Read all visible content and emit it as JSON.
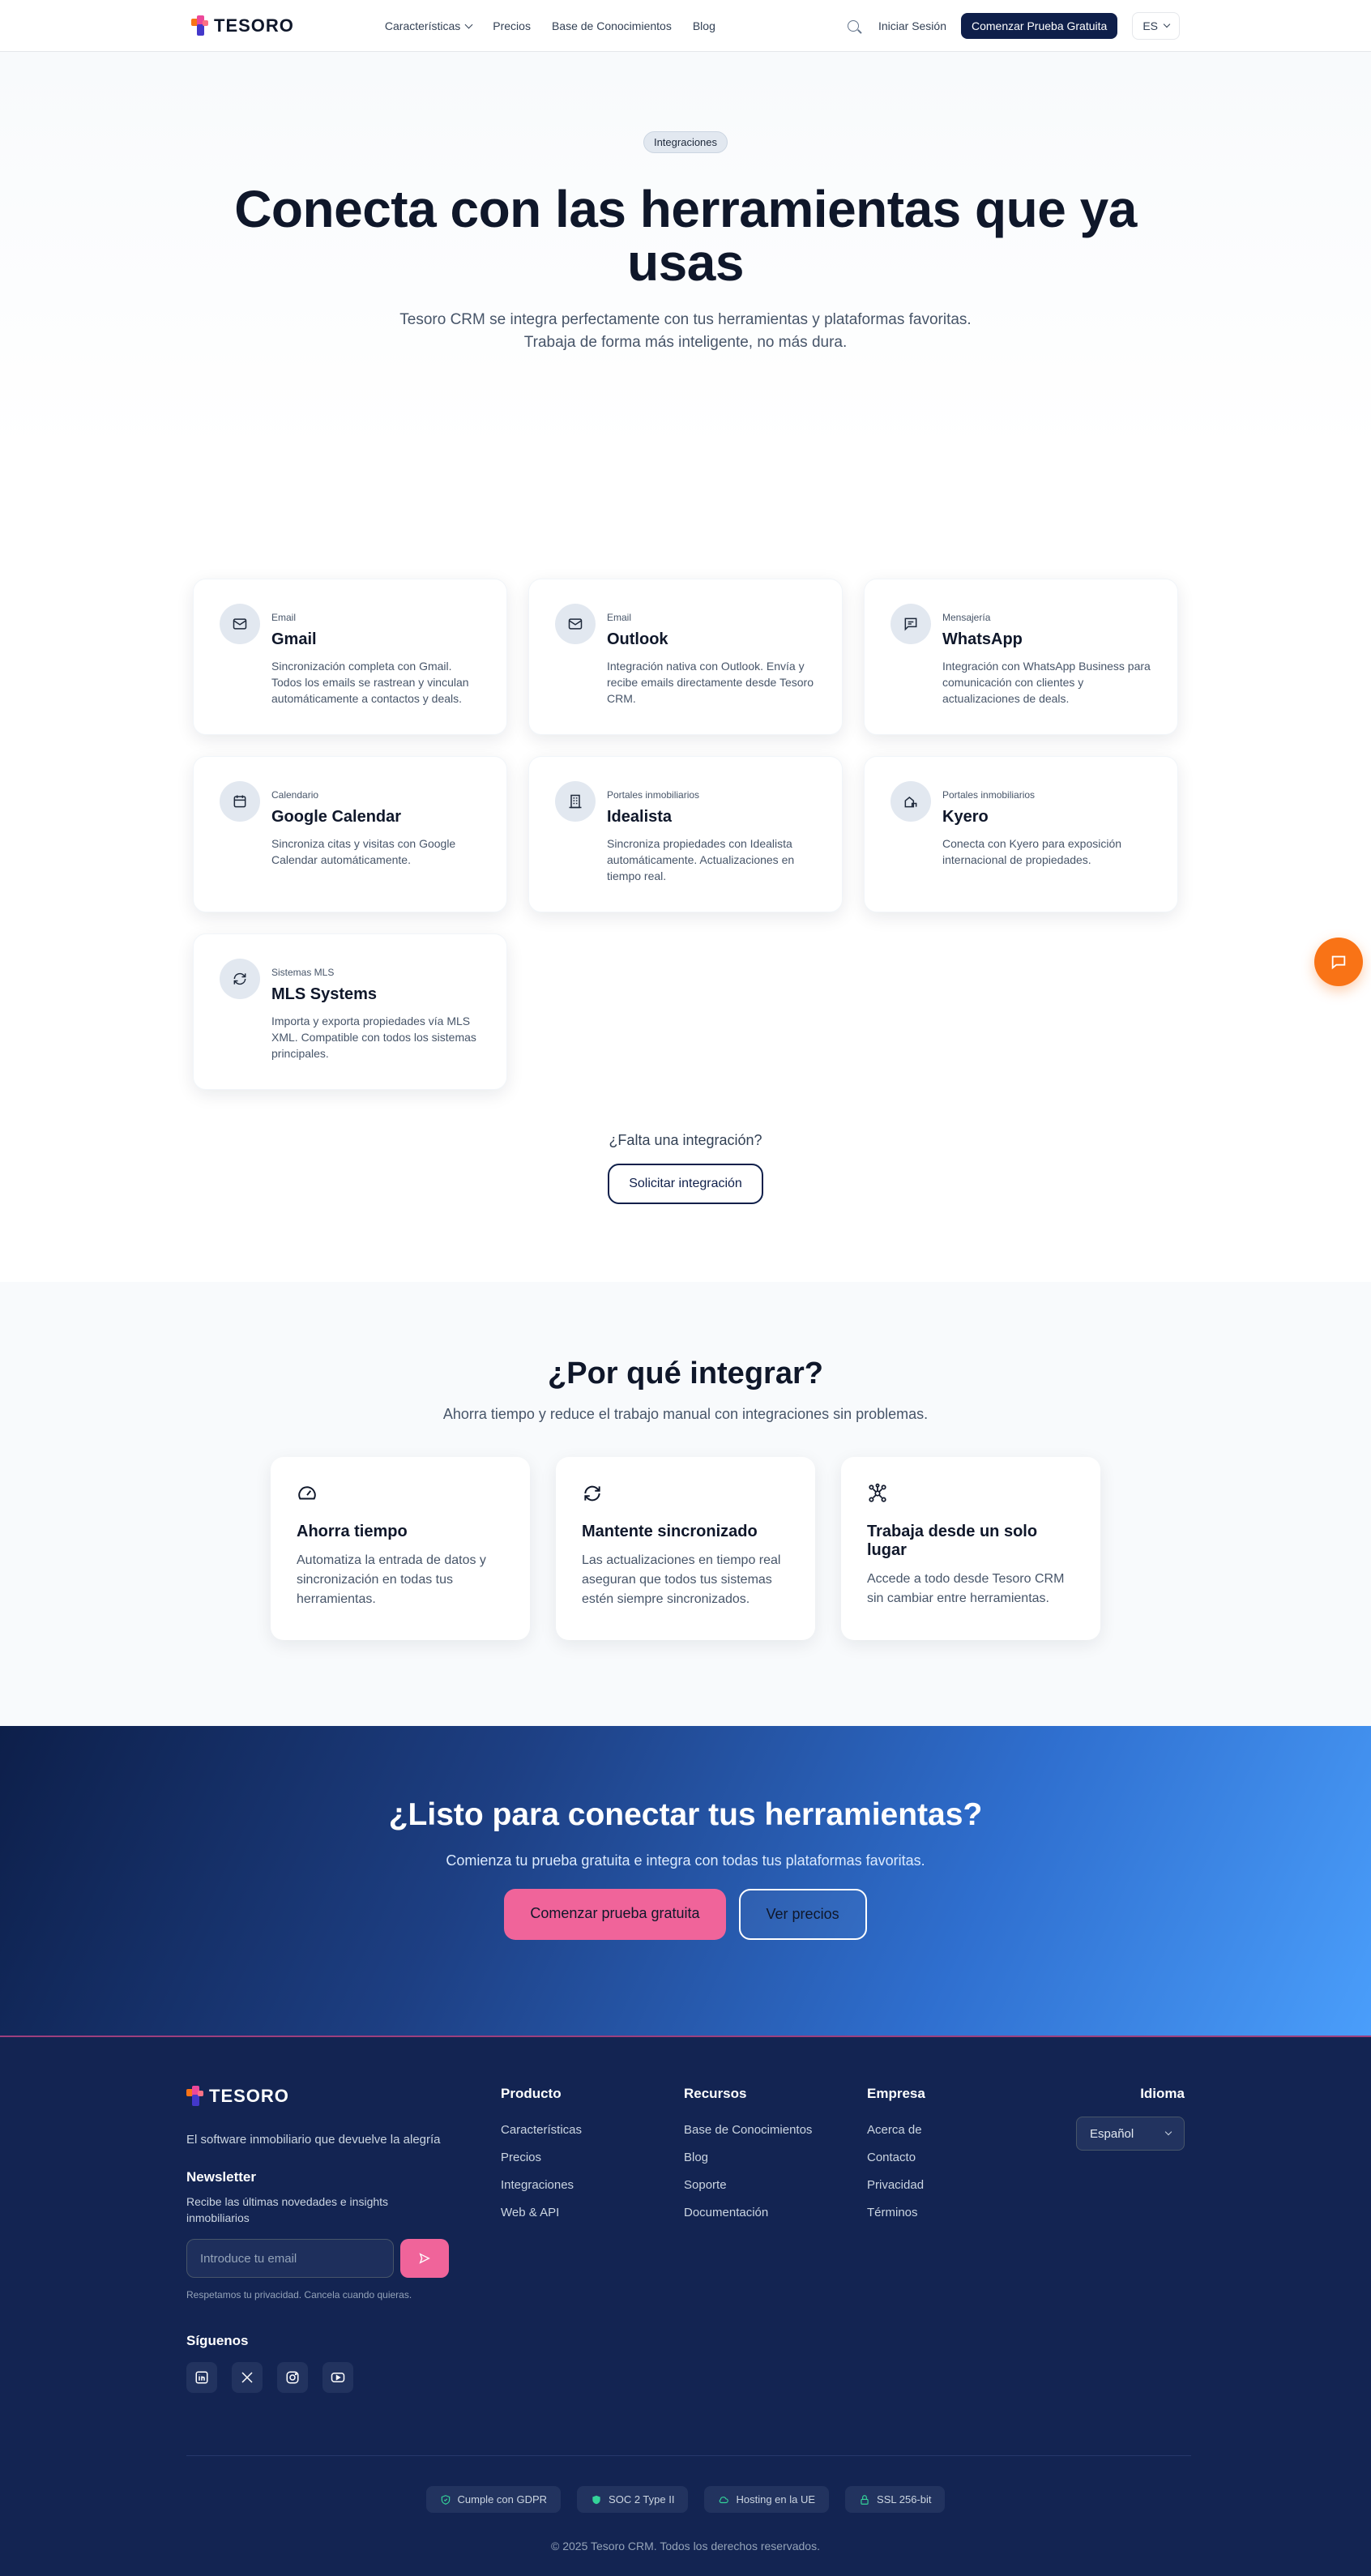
{
  "nav": {
    "brand": "TESORO",
    "links": [
      "Características",
      "Precios",
      "Base de Conocimientos",
      "Blog"
    ],
    "login": "Iniciar Sesión",
    "cta": "Comenzar Prueba Gratuita",
    "lang": "ES"
  },
  "hero": {
    "badge": "Integraciones",
    "title": "Conecta con las herramientas que ya usas",
    "subtitle_line1": "Tesoro CRM se integra perfectamente con tus herramientas y plataformas favoritas.",
    "subtitle_line2": "Trabaja de forma más inteligente, no más dura."
  },
  "integrations": [
    {
      "category": "Email",
      "name": "Gmail",
      "icon": "mail-icon",
      "desc": "Sincronización completa con Gmail. Todos los emails se rastrean y vinculan automáticamente a contactos y deals."
    },
    {
      "category": "Email",
      "name": "Outlook",
      "icon": "mail-icon",
      "desc": "Integración nativa con Outlook. Envía y recibe emails directamente desde Tesoro CRM."
    },
    {
      "category": "Mensajería",
      "name": "WhatsApp",
      "icon": "message-icon",
      "desc": "Integración con WhatsApp Business para comunicación con clientes y actualizaciones de deals."
    },
    {
      "category": "Calendario",
      "name": "Google Calendar",
      "icon": "calendar-icon",
      "desc": "Sincroniza citas y visitas con Google Calendar automáticamente."
    },
    {
      "category": "Portales inmobiliarios",
      "name": "Idealista",
      "icon": "building-icon",
      "desc": "Sincroniza propiedades con Idealista automáticamente. Actualizaciones en tiempo real."
    },
    {
      "category": "Portales inmobiliarios",
      "name": "Kyero",
      "icon": "house-icon",
      "desc": "Conecta con Kyero para exposición internacional de propiedades."
    },
    {
      "category": "Sistemas MLS",
      "name": "MLS Systems",
      "icon": "sync-icon",
      "desc": "Importa y exporta propiedades vía MLS XML. Compatible con todos los sistemas principales."
    }
  ],
  "missing": {
    "question": "¿Falta una integración?",
    "button": "Solicitar integración"
  },
  "why": {
    "title": "¿Por qué integrar?",
    "subtitle": "Ahorra tiempo y reduce el trabajo manual con integraciones sin problemas.",
    "items": [
      {
        "icon": "gauge-icon",
        "title": "Ahorra tiempo",
        "desc": "Automatiza la entrada de datos y sincronización en todas tus herramientas."
      },
      {
        "icon": "sync-icon",
        "title": "Mantente sincronizado",
        "desc": "Las actualizaciones en tiempo real aseguran que todos tus sistemas estén siempre sincronizados."
      },
      {
        "icon": "network-icon",
        "title": "Trabaja desde un solo lugar",
        "desc": "Accede a todo desde Tesoro CRM sin cambiar entre herramientas."
      }
    ]
  },
  "cta": {
    "title": "¿Listo para conectar tus herramientas?",
    "subtitle": "Comienza tu prueba gratuita e integra con todas tus plataformas favoritas.",
    "primary": "Comenzar prueba gratuita",
    "secondary": "Ver precios"
  },
  "footer": {
    "brand": "TESORO",
    "tagline": "El software inmobiliario que devuelve la alegría",
    "newsletter_title": "Newsletter",
    "newsletter_desc": "Recibe las últimas novedades e insights inmobiliarios",
    "email_placeholder": "Introduce tu email",
    "privacy": "Respetamos tu privacidad. Cancela cuando quieras.",
    "follow": "Síguenos",
    "columns": [
      {
        "title": "Producto",
        "links": [
          "Características",
          "Precios",
          "Integraciones",
          "Web & API"
        ]
      },
      {
        "title": "Recursos",
        "links": [
          "Base de Conocimientos",
          "Blog",
          "Soporte",
          "Documentación"
        ]
      },
      {
        "title": "Empresa",
        "links": [
          "Acerca de",
          "Contacto",
          "Privacidad",
          "Términos"
        ]
      }
    ],
    "language_title": "Idioma",
    "language_value": "Español",
    "badges": [
      "Cumple con GDPR",
      "SOC 2 Type II",
      "Hosting en la UE",
      "SSL 256-bit"
    ],
    "copyright": "© 2025 Tesoro CRM. Todos los derechos reservados."
  }
}
